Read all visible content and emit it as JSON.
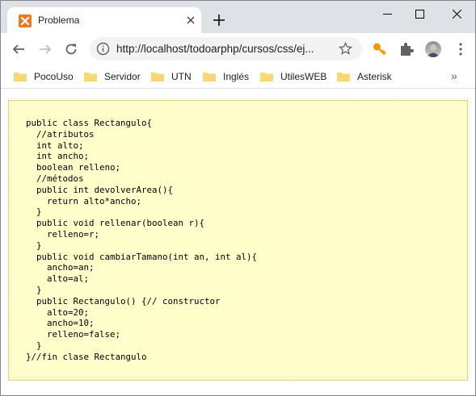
{
  "tab": {
    "title": "Problema",
    "favicon": "xampp-icon"
  },
  "toolbar": {
    "url": "http://localhost/todoarphp/cursos/css/ej..."
  },
  "bookmarks": [
    {
      "label": "PocoUso"
    },
    {
      "label": "Servidor"
    },
    {
      "label": "UTN"
    },
    {
      "label": "Inglés"
    },
    {
      "label": "UtilesWEB"
    },
    {
      "label": "Asterisk"
    }
  ],
  "bookmarks_more": "»",
  "code": "public class Rectangulo{\n  //atributos\n  int alto;\n  int ancho;\n  boolean relleno;\n  //métodos\n  public int devolverArea(){\n    return alto*ancho;\n  }\n  public void rellenar(boolean r){\n    relleno=r;\n  }\n  public void cambiarTamano(int an, int al){\n    ancho=an;\n    alto=al;\n  }\n  public Rectangulo() {// constructor\n    alto=20;\n    ancho=10;\n    relleno=false;\n  }\n}//fin clase Rectangulo",
  "colors": {
    "titlebar": "#dee1e6",
    "codebox_bg": "#ffffcc",
    "codebox_border": "#c9b24a",
    "favicon": "#f07822",
    "key_icon": "#f29900"
  }
}
